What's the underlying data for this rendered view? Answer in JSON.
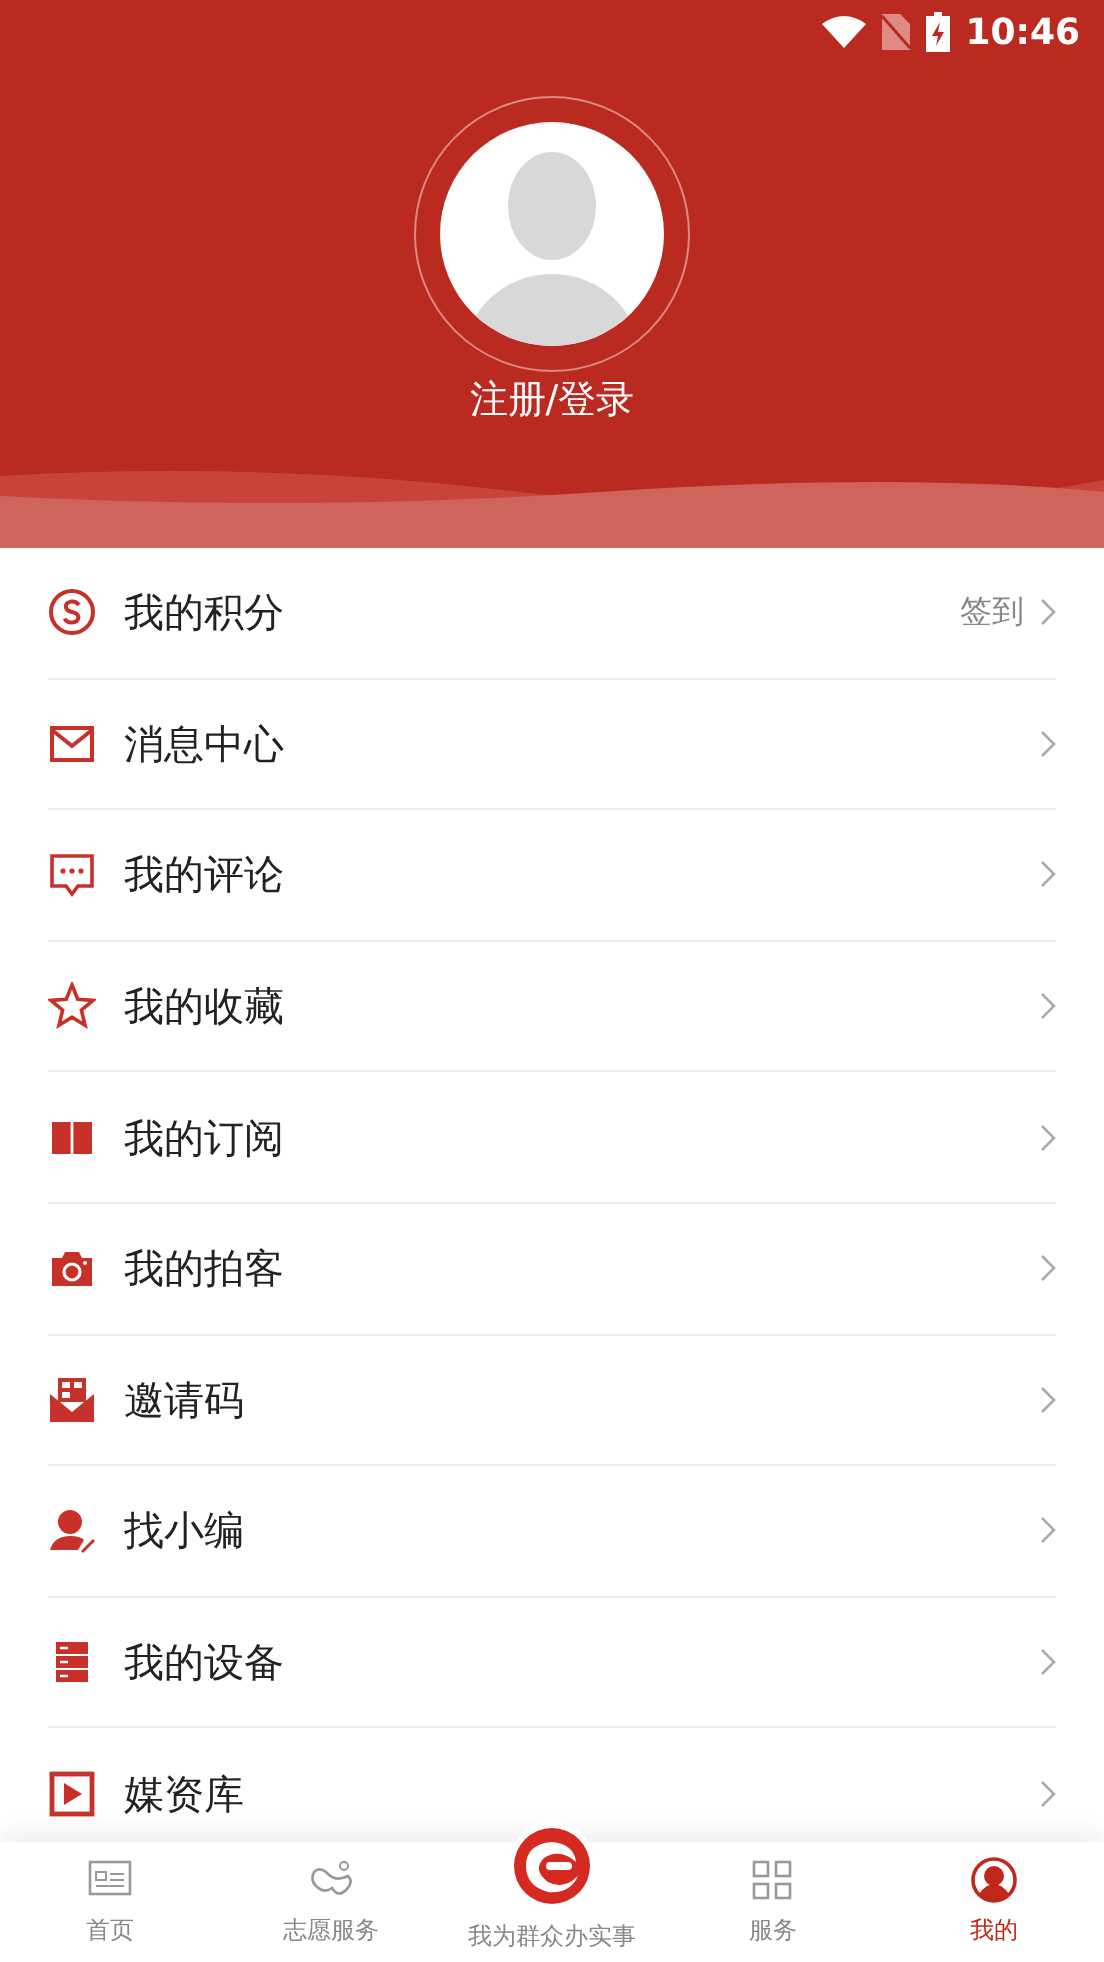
{
  "status_bar": {
    "time": "10:46"
  },
  "profile": {
    "login_label": "注册/登录"
  },
  "menu": [
    {
      "label": "我的积分",
      "action": "签到"
    },
    {
      "label": "消息中心"
    },
    {
      "label": "我的评论"
    },
    {
      "label": "我的收藏"
    },
    {
      "label": "我的订阅"
    },
    {
      "label": "我的拍客"
    },
    {
      "label": "邀请码"
    },
    {
      "label": "找小编"
    },
    {
      "label": "我的设备"
    },
    {
      "label": "媒资库"
    }
  ],
  "tab_bar": [
    {
      "label": "首页",
      "selected": false,
      "kind": "normal"
    },
    {
      "label": "志愿服务",
      "selected": false,
      "kind": "normal"
    },
    {
      "label": "我为群众办实事",
      "selected": false,
      "kind": "center"
    },
    {
      "label": "服务",
      "selected": false,
      "kind": "normal"
    },
    {
      "label": "我的",
      "selected": true,
      "kind": "normal"
    }
  ]
}
